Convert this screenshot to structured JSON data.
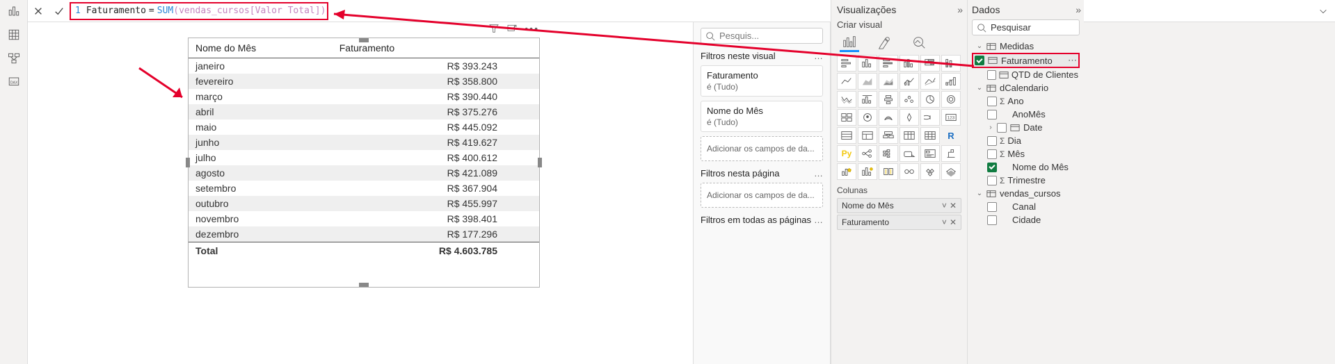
{
  "formula": {
    "line_no": "1",
    "measure_name": "Faturamento",
    "eq": "=",
    "fn": "SUM",
    "par_open": "(",
    "ref": "vendas_cursos[Valor Total]",
    "par_close": ")"
  },
  "table": {
    "headers": {
      "c1": "Nome do Mês",
      "c2": "Faturamento"
    },
    "rows": [
      {
        "m": "janeiro",
        "v": "R$ 393.243"
      },
      {
        "m": "fevereiro",
        "v": "R$ 358.800"
      },
      {
        "m": "março",
        "v": "R$ 390.440"
      },
      {
        "m": "abril",
        "v": "R$ 375.276"
      },
      {
        "m": "maio",
        "v": "R$ 445.092"
      },
      {
        "m": "junho",
        "v": "R$ 419.627"
      },
      {
        "m": "julho",
        "v": "R$ 400.612"
      },
      {
        "m": "agosto",
        "v": "R$ 421.089"
      },
      {
        "m": "setembro",
        "v": "R$ 367.904"
      },
      {
        "m": "outubro",
        "v": "R$ 455.997"
      },
      {
        "m": "novembro",
        "v": "R$ 398.401"
      },
      {
        "m": "dezembro",
        "v": "R$ 177.296"
      }
    ],
    "total": {
      "label": "Total",
      "v": "R$ 4.603.785"
    }
  },
  "filters": {
    "search_placeholder": "Pesquis...",
    "sec_visual": "Filtros neste visual",
    "card_faturamento_name": "Faturamento",
    "card_faturamento_val": "é (Tudo)",
    "card_mes_name": "Nome do Mês",
    "card_mes_val": "é (Tudo)",
    "add_here": "Adicionar os campos de da...",
    "sec_page": "Filtros nesta página",
    "sec_all": "Filtros em todas as páginas"
  },
  "viz": {
    "title": "Visualizações",
    "subtitle": "Criar visual",
    "columns_label": "Colunas",
    "well1": "Nome do Mês",
    "well2": "Faturamento"
  },
  "data": {
    "title": "Dados",
    "search_placeholder": "Pesquisar",
    "tables": {
      "medidas": "Medidas",
      "faturamento": "Faturamento",
      "qtd": "QTD de Clientes",
      "dcal": "dCalendario",
      "ano": "Ano",
      "anomes": "AnoMês",
      "date": "Date",
      "dia": "Dia",
      "mes": "Mês",
      "nome_mes": "Nome do Mês",
      "trimestre": "Trimestre",
      "vendas": "vendas_cursos",
      "canal": "Canal",
      "cidade": "Cidade"
    }
  }
}
